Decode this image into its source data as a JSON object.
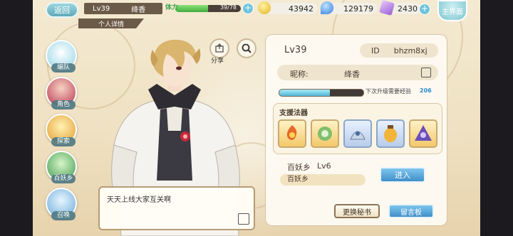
{
  "topbar": {
    "back_label": "返回",
    "level": "Lv39",
    "player_name": "绛香",
    "stamina_icon": "体力",
    "stamina_text": "39/78",
    "stamina_fraction": 0.5,
    "coins": "43942",
    "gems": "129179",
    "tickets": "2430",
    "main_label": "主界面"
  },
  "profile_tab": "个人详情",
  "sidebar": {
    "items": [
      {
        "label": "编队",
        "icon": "team-icon"
      },
      {
        "label": "角色",
        "icon": "character-icon"
      },
      {
        "label": "探索",
        "icon": "explore-icon"
      },
      {
        "label": "百妖乡",
        "icon": "village-icon"
      },
      {
        "label": "召唤",
        "icon": "summon-icon"
      }
    ]
  },
  "share_label": "分享",
  "speech": "天天上线大家互关啊",
  "panel": {
    "level": "Lv39",
    "id_label": "ID",
    "id_value": "bhzm8xj",
    "nickname_label": "昵称:",
    "nickname_value": "绛香",
    "exp_label": "下次升级需要经验",
    "exp_value": "206",
    "exp_fraction": 0.6,
    "support_title": "支援法器",
    "artifacts": [
      "fire-artifact-icon",
      "leaf-artifact-icon",
      "silver-artifact-icon",
      "lantern-artifact-icon",
      "purple-artifact-icon"
    ],
    "village_name": "百妖乡",
    "village_level": "Lv6",
    "village_sub": "百妖乡",
    "enter_label": "进入",
    "change_secretary": "更换秘书",
    "message_board": "留言板"
  },
  "colors": {
    "accent_blue": "#3f8fc9",
    "stamina_green": "#3fae3a",
    "panel_bg": "#fdfaf2",
    "brown": "#6b5a48"
  }
}
